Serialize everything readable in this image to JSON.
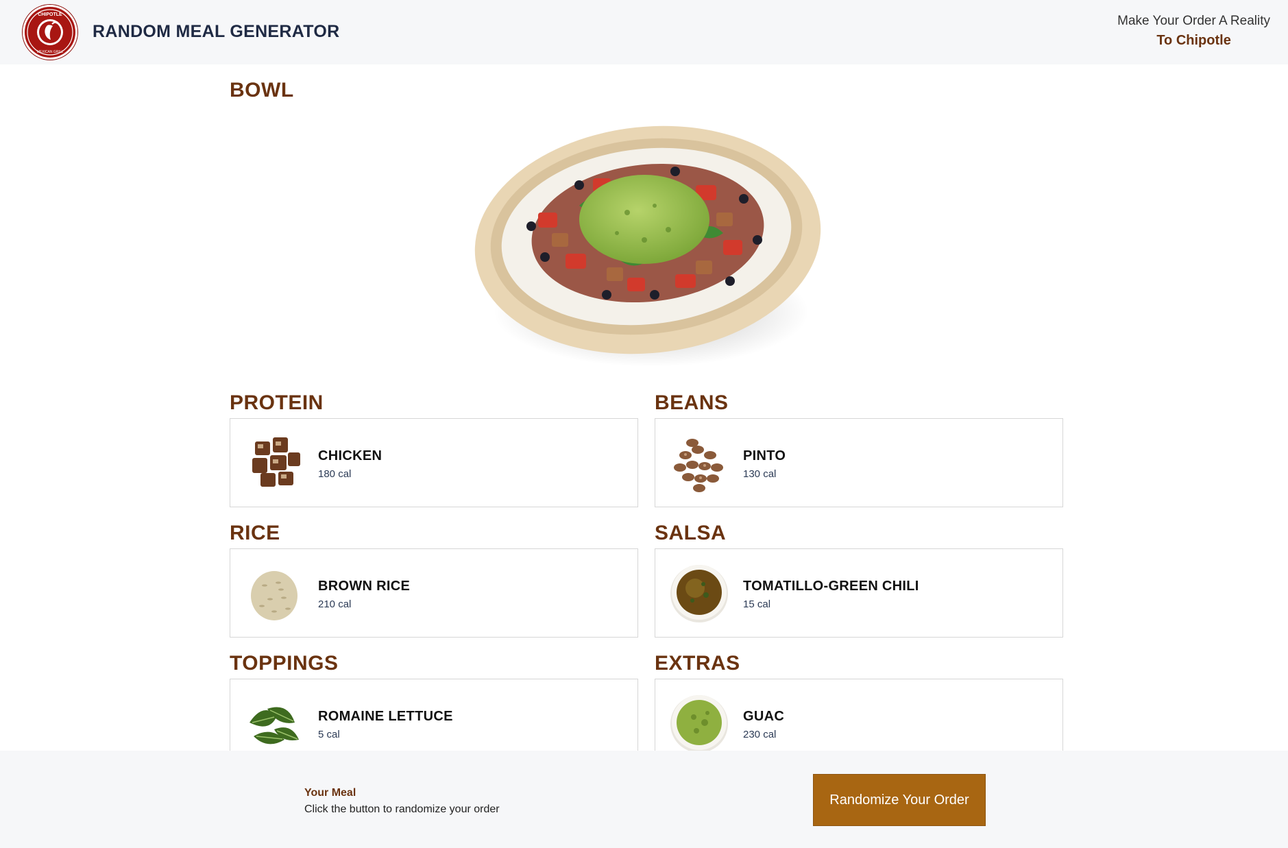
{
  "header": {
    "title": "RANDOM MEAL GENERATOR",
    "cta_line1": "Make Your Order A Reality",
    "cta_line2": "To Chipotle",
    "logo_text_top": "CHIPOTLE",
    "logo_text_bottom": "MEXICAN GRILL"
  },
  "bowl": {
    "title": "BOWL"
  },
  "categories": [
    {
      "title": "PROTEIN",
      "item": "CHICKEN",
      "cal": "180 cal",
      "icon": "chicken-icon"
    },
    {
      "title": "BEANS",
      "item": "PINTO",
      "cal": "130 cal",
      "icon": "pinto-beans-icon"
    },
    {
      "title": "RICE",
      "item": "BROWN RICE",
      "cal": "210 cal",
      "icon": "brown-rice-icon"
    },
    {
      "title": "SALSA",
      "item": "TOMATILLO-GREEN CHILI",
      "cal": "15 cal",
      "icon": "salsa-bowl-icon"
    },
    {
      "title": "TOPPINGS",
      "item": "ROMAINE LETTUCE",
      "cal": "5 cal",
      "icon": "lettuce-icon"
    },
    {
      "title": "EXTRAS",
      "item": "GUAC",
      "cal": "230 cal",
      "icon": "guac-bowl-icon"
    }
  ],
  "footer": {
    "meal_label": "Your Meal",
    "meal_hint": "Click the button to randomize your order",
    "button_label": "Randomize Your Order"
  },
  "colors": {
    "accent_brown": "#6a3310",
    "button": "#a86612",
    "brand_red": "#a81612"
  }
}
